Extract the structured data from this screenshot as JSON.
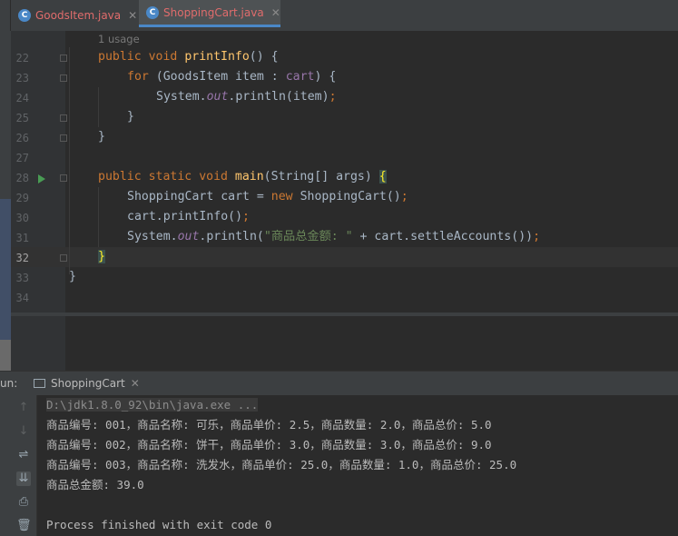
{
  "tabs": [
    {
      "label": "GoodsItem.java",
      "icon": "java-class-icon",
      "active": false
    },
    {
      "label": "ShoppingCart.java",
      "icon": "java-class-icon",
      "active": true
    }
  ],
  "editor": {
    "usage_hint": "1 usage",
    "line_numbers": [
      "22",
      "23",
      "24",
      "25",
      "26",
      "27",
      "28",
      "29",
      "30",
      "31",
      "32",
      "33",
      "34"
    ],
    "current_line": "32",
    "lines": {
      "l22": {
        "kw1": "public",
        "kw2": "void",
        "fn": "printInfo",
        "rest": "() {"
      },
      "l23": {
        "kw": "for",
        "a": " (GoodsItem item : ",
        "kw2": "cart",
        "b": ") {"
      },
      "l24": {
        "a": "System.",
        "st": "out",
        "b": ".println(item)",
        "c": ";"
      },
      "l25": {
        "text": "}"
      },
      "l26": {
        "text": "}"
      },
      "l28": {
        "kw1": "public",
        "kw2": "static",
        "kw3": "void",
        "fn": "main",
        "rest": "(String[] args) ",
        "brace": "{"
      },
      "l29": {
        "a": "ShoppingCart cart = ",
        "kw": "new",
        "b": " ShoppingCart()",
        "c": ";"
      },
      "l30": {
        "a": "cart.printInfo()",
        "c": ";"
      },
      "l31": {
        "a": "System.",
        "st": "out",
        "b": ".println(",
        "str": "\"商品总金额: \"",
        "d": " + cart.settleAccounts())",
        "c": ";"
      },
      "l32": {
        "brace": "}"
      },
      "l33": {
        "text": "}"
      }
    }
  },
  "run_panel": {
    "label": "un:",
    "tab_label": "ShoppingCart",
    "console": [
      "D:\\jdk1.8.0_92\\bin\\java.exe ...",
      "商品编号: 001，商品名称: 可乐，商品单价: 2.5，商品数量: 2.0，商品总价: 5.0",
      "商品编号: 002，商品名称: 饼干，商品单价: 3.0，商品数量: 3.0，商品总价: 9.0",
      "商品编号: 003，商品名称: 洗发水，商品单价: 25.0，商品数量: 1.0，商品总价: 25.0",
      "商品总金额: 39.0",
      "",
      "Process finished with exit code 0"
    ]
  },
  "colors": {
    "keyword": "#cc7832",
    "function": "#ffc66d",
    "static_field": "#9876aa",
    "string": "#6a8759",
    "text": "#a9b7c6"
  }
}
